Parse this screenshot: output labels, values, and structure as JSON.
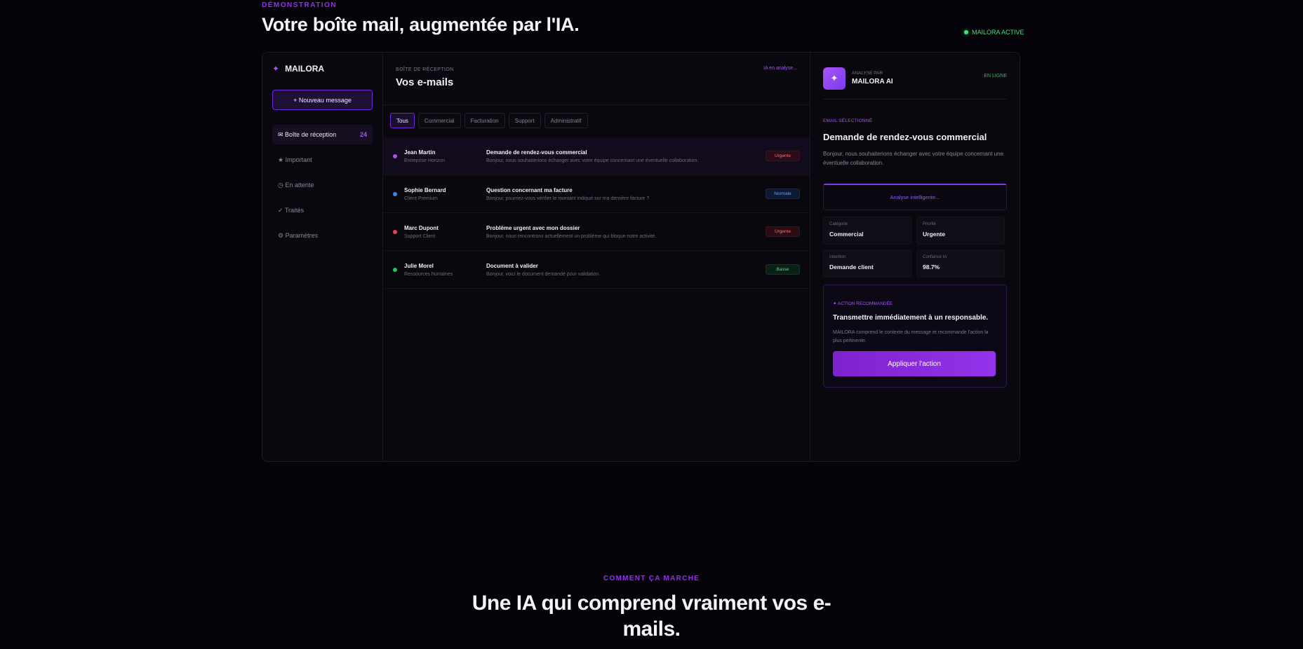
{
  "hero": {
    "eyebrow": "DÉMONSTRATION",
    "title": "Votre boîte mail, augmentée par l'IA.",
    "status": "MAILORA ACTIVE"
  },
  "sidebar": {
    "brand": "MAILORA",
    "new_message": "+ Nouveau message",
    "items": [
      {
        "label": "✉ Boîte de réception",
        "count": "24"
      },
      {
        "label": "★ Important"
      },
      {
        "label": "◷ En attente"
      },
      {
        "label": "✓ Traités"
      },
      {
        "label": "⚙ Paramètres"
      }
    ]
  },
  "inbox": {
    "subtitle": "BOÎTE DE RÉCEPTION",
    "title": "Vos e-mails",
    "ai_status": "IA en analyse...",
    "filters": [
      "Tous",
      "Commercial",
      "Facturation",
      "Support",
      "Administratif"
    ],
    "emails": [
      {
        "name": "Jean Martin",
        "company": "Entreprise Horizon",
        "subject": "Demande de rendez-vous commercial",
        "preview": "Bonjour, nous souhaiterions échanger avec votre équipe concernant une éventuelle collaboration.",
        "priority": "Urgente",
        "dot": "#a855f7"
      },
      {
        "name": "Sophie Bernard",
        "company": "Client Premium",
        "subject": "Question concernant ma facture",
        "preview": "Bonjour, pourriez-vous vérifier le montant indiqué sur ma dernière facture ?",
        "priority": "Normale",
        "dot": "#3b82f6"
      },
      {
        "name": "Marc Dupont",
        "company": "Support Client",
        "subject": "Problème urgent avec mon dossier",
        "preview": "Bonjour, nous rencontrons actuellement un problème qui bloque notre activité.",
        "priority": "Urgente",
        "dot": "#ef4444"
      },
      {
        "name": "Julie Morel",
        "company": "Ressources humaines",
        "subject": "Document à valider",
        "preview": "Bonjour, voici le document demandé pour validation.",
        "priority": "Basse",
        "dot": "#22c55e"
      }
    ]
  },
  "panel": {
    "analyzed_by": "ANALYSE PAR",
    "ai_name": "MAILORA AI",
    "status": "EN LIGNE",
    "selected_label": "EMAIL SÉLECTIONNÉ",
    "selected_title": "Demande de rendez-vous commercial",
    "selected_body": "Bonjour, nous souhaiterions échanger avec votre équipe concernant une éventuelle collaboration.",
    "analyzing": "Analyse intelligente...",
    "metrics": [
      {
        "key": "Catégorie",
        "value": "Commercial"
      },
      {
        "key": "Priorité",
        "value": "Urgente"
      },
      {
        "key": "Intention",
        "value": "Demande client"
      },
      {
        "key": "Confiance IA",
        "value": "98.7%"
      }
    ],
    "reco_label": "✦ ACTION RECOMMANDÉE",
    "reco_title": "Transmettre immédiatement à un responsable.",
    "reco_desc": "MAILORA comprend le contexte du message et recommande l'action la plus pertinente.",
    "apply_label": "Appliquer l'action"
  },
  "section": {
    "eyebrow": "COMMENT ÇA MARCHE",
    "title_line1": "Une IA qui comprend vraiment vos e-",
    "title_line2": "mails."
  }
}
